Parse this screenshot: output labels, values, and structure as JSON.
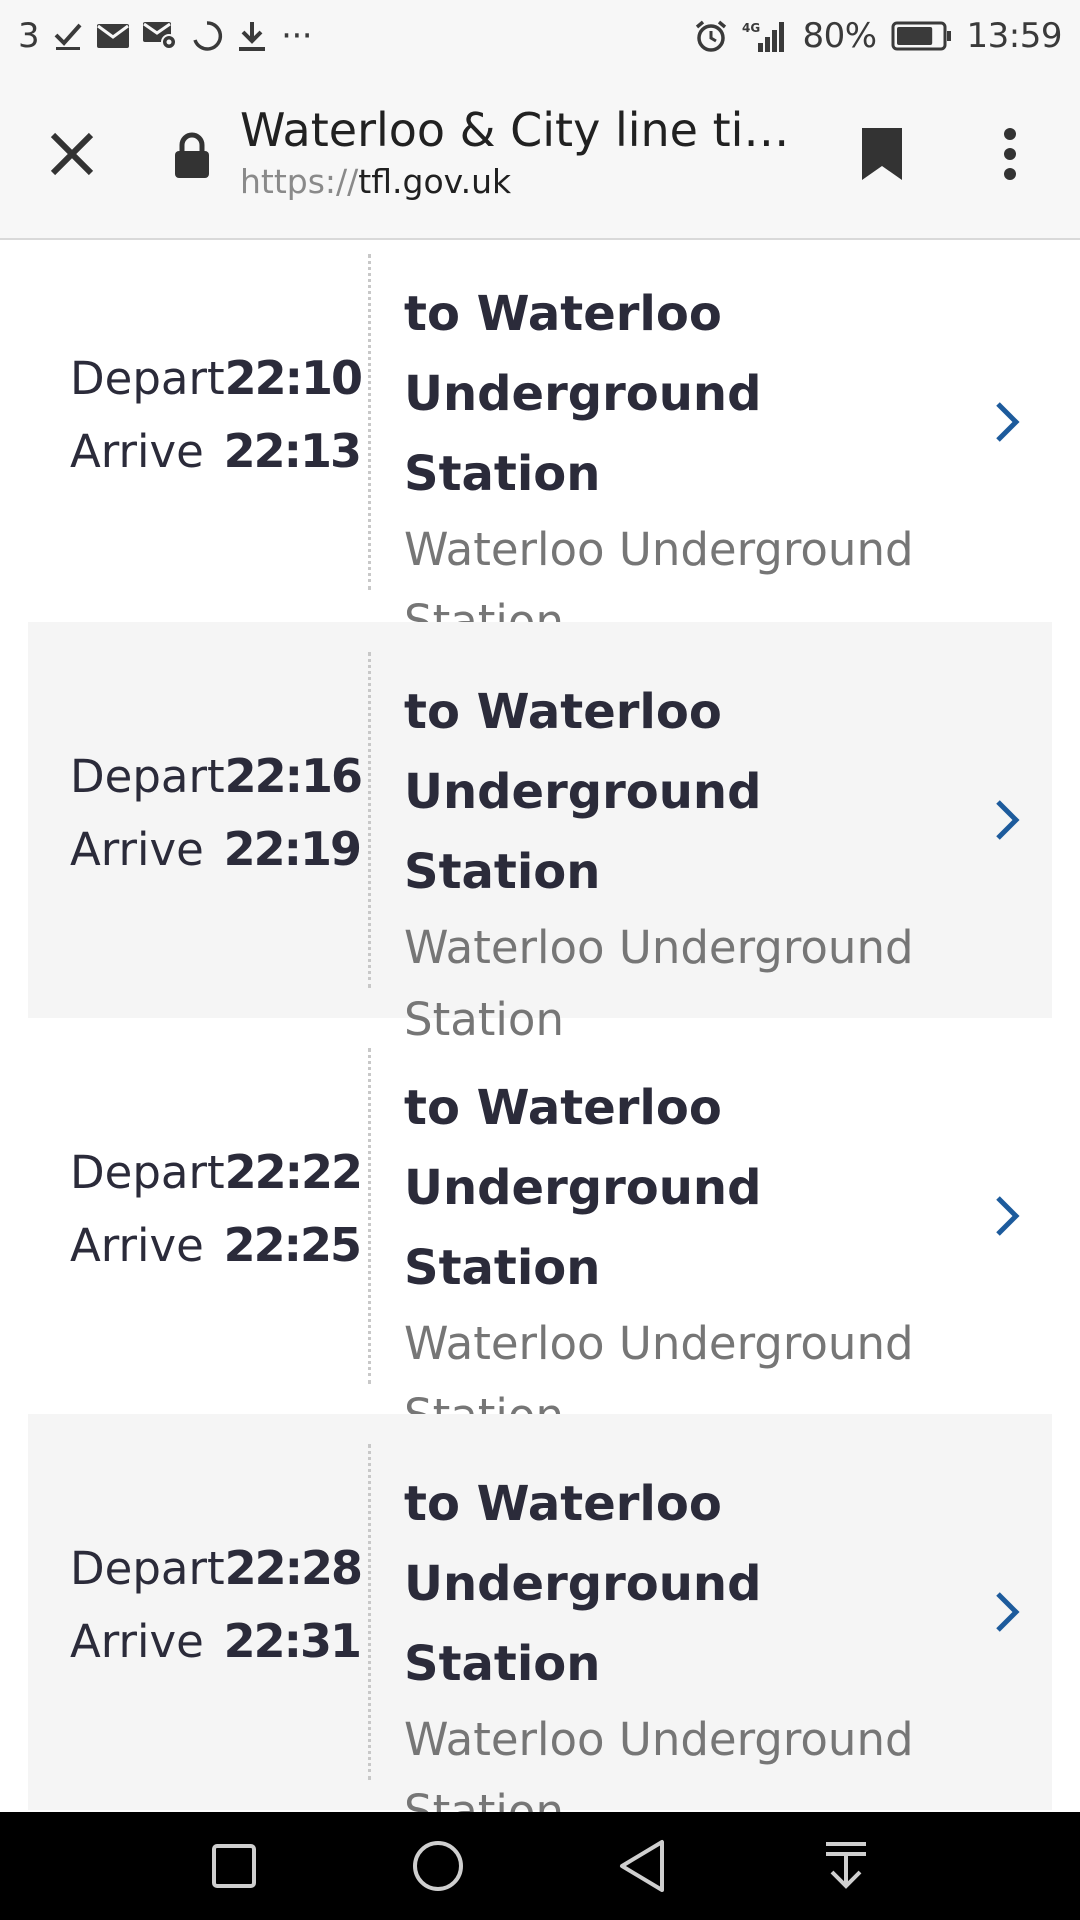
{
  "status_bar": {
    "notification_count": "3",
    "left_icons": [
      "check-icon",
      "email-icon",
      "email-settings-icon",
      "sync-icon",
      "download-icon",
      "more-notifications-icon"
    ],
    "more_indicator": "···",
    "network_label": "4G",
    "battery_percent": "80%",
    "battery_level": 0.8,
    "time": "13:59"
  },
  "browser": {
    "title": "Waterloo & City line tim...",
    "url_scheme": "https://",
    "url_host": "tfl.gov.uk"
  },
  "departures": [
    {
      "depart_label": "Depart",
      "depart_time": "22:10",
      "arrive_label": "Arrive",
      "arrive_time": "22:13",
      "destination_line1": "to Waterloo",
      "destination_line2": "Underground Station",
      "station_line1": "Waterloo Underground",
      "station_line2": "Station"
    },
    {
      "depart_label": "Depart",
      "depart_time": "22:16",
      "arrive_label": "Arrive",
      "arrive_time": "22:19",
      "destination_line1": "to Waterloo",
      "destination_line2": "Underground Station",
      "station_line1": "Waterloo Underground",
      "station_line2": "Station"
    },
    {
      "depart_label": "Depart",
      "depart_time": "22:22",
      "arrive_label": "Arrive",
      "arrive_time": "22:25",
      "destination_line1": "to Waterloo",
      "destination_line2": "Underground Station",
      "station_line1": "Waterloo Underground",
      "station_line2": "Station"
    },
    {
      "depart_label": "Depart",
      "depart_time": "22:28",
      "arrive_label": "Arrive",
      "arrive_time": "22:31",
      "destination_line1": "to Waterloo",
      "destination_line2": "Underground Station",
      "station_line1": "Waterloo Underground",
      "station_line2": "Station"
    }
  ],
  "colors": {
    "chevron": "#1d5b9c",
    "title_text": "#2b2b3a",
    "subtitle_text": "#767676",
    "shaded_row": "#f5f5f5"
  },
  "nav_bar": {
    "icons": [
      "recent-apps-icon",
      "home-icon",
      "back-icon",
      "notification-shade-icon"
    ]
  }
}
